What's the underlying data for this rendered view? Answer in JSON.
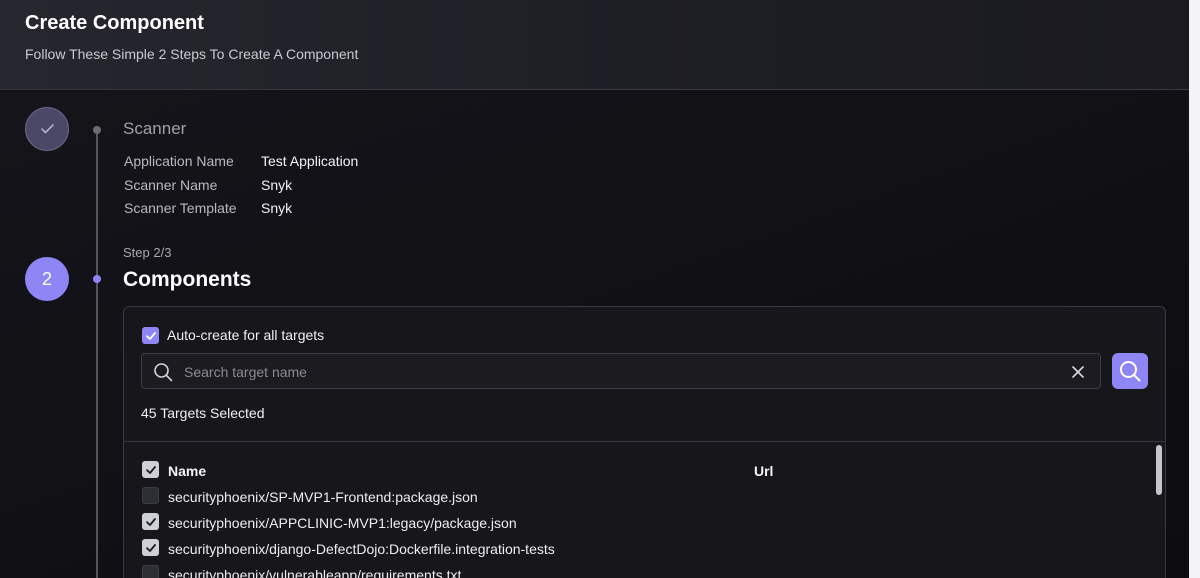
{
  "header": {
    "title": "Create Component",
    "subtitle": "Follow These Simple 2 Steps To Create A Component"
  },
  "stepper": {
    "active_step_number": "2",
    "completed_step": {
      "title": "Scanner",
      "fields": [
        {
          "label": "Application Name",
          "value": "Test Application"
        },
        {
          "label": "Scanner Name",
          "value": "Snyk"
        },
        {
          "label": "Scanner Template",
          "value": "Snyk"
        }
      ]
    },
    "current_step": {
      "step_label": "Step 2/3",
      "title": "Components"
    }
  },
  "components": {
    "auto_create_label": "Auto-create for all targets",
    "auto_create_checked": true,
    "search": {
      "placeholder": "Search target name",
      "value": ""
    },
    "targets_selected": "45 Targets Selected",
    "table": {
      "columns": [
        "Name",
        "Url"
      ],
      "header_checked": true,
      "rows": [
        {
          "name": "securityphoenix/SP-MVP1-Frontend:package.json",
          "checked": false
        },
        {
          "name": "securityphoenix/APPCLINIC-MVP1:legacy/package.json",
          "checked": true
        },
        {
          "name": "securityphoenix/django-DefectDojo:Dockerfile.integration-tests",
          "checked": true
        },
        {
          "name": "securityphoenix/vulnerableapp/requirements.txt",
          "checked": false
        }
      ]
    }
  },
  "colors": {
    "accent": "#8f86f6",
    "background": "#111114",
    "card_border": "#3a3a44"
  },
  "icons": {
    "completed_step": "check-icon",
    "search": "search-icon",
    "clear": "close-icon",
    "search_button": "search-icon"
  }
}
